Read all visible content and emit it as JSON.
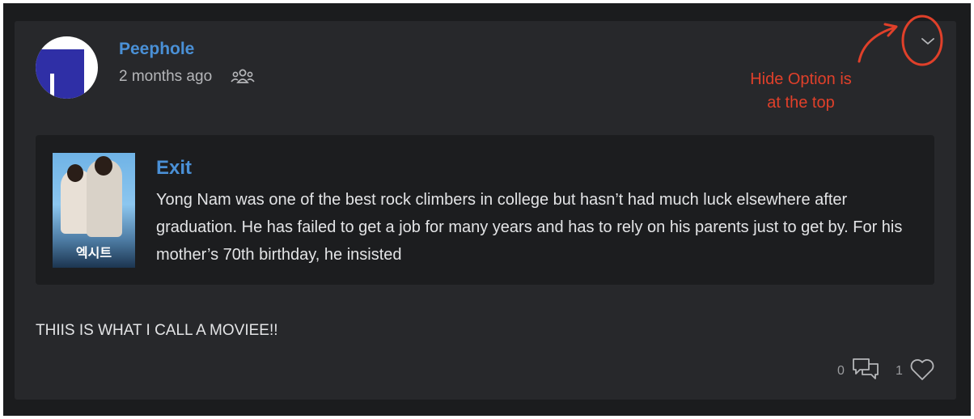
{
  "post": {
    "username": "Peephole",
    "timestamp": "2 months ago",
    "visibility_icon": "people-icon",
    "text": "THIIS IS WHAT I CALL A MOVIEE!!",
    "comment_count": "0",
    "like_count": "1"
  },
  "movie": {
    "title": "Exit",
    "poster_title": "엑시트",
    "description": "Yong Nam was one of the best rock climbers in college but hasn’t had much luck elsewhere after graduation. He has failed to get a job for many years and has to rely on his parents just to get by. For his mother’s 70th birthday, he insisted"
  },
  "annotation": {
    "text_line1": "Hide Option is",
    "text_line2": "at the top"
  },
  "colors": {
    "accent": "#4a90d6",
    "annotation": "#e0402a",
    "card": "#27282b",
    "background": "#1b1c1e"
  }
}
